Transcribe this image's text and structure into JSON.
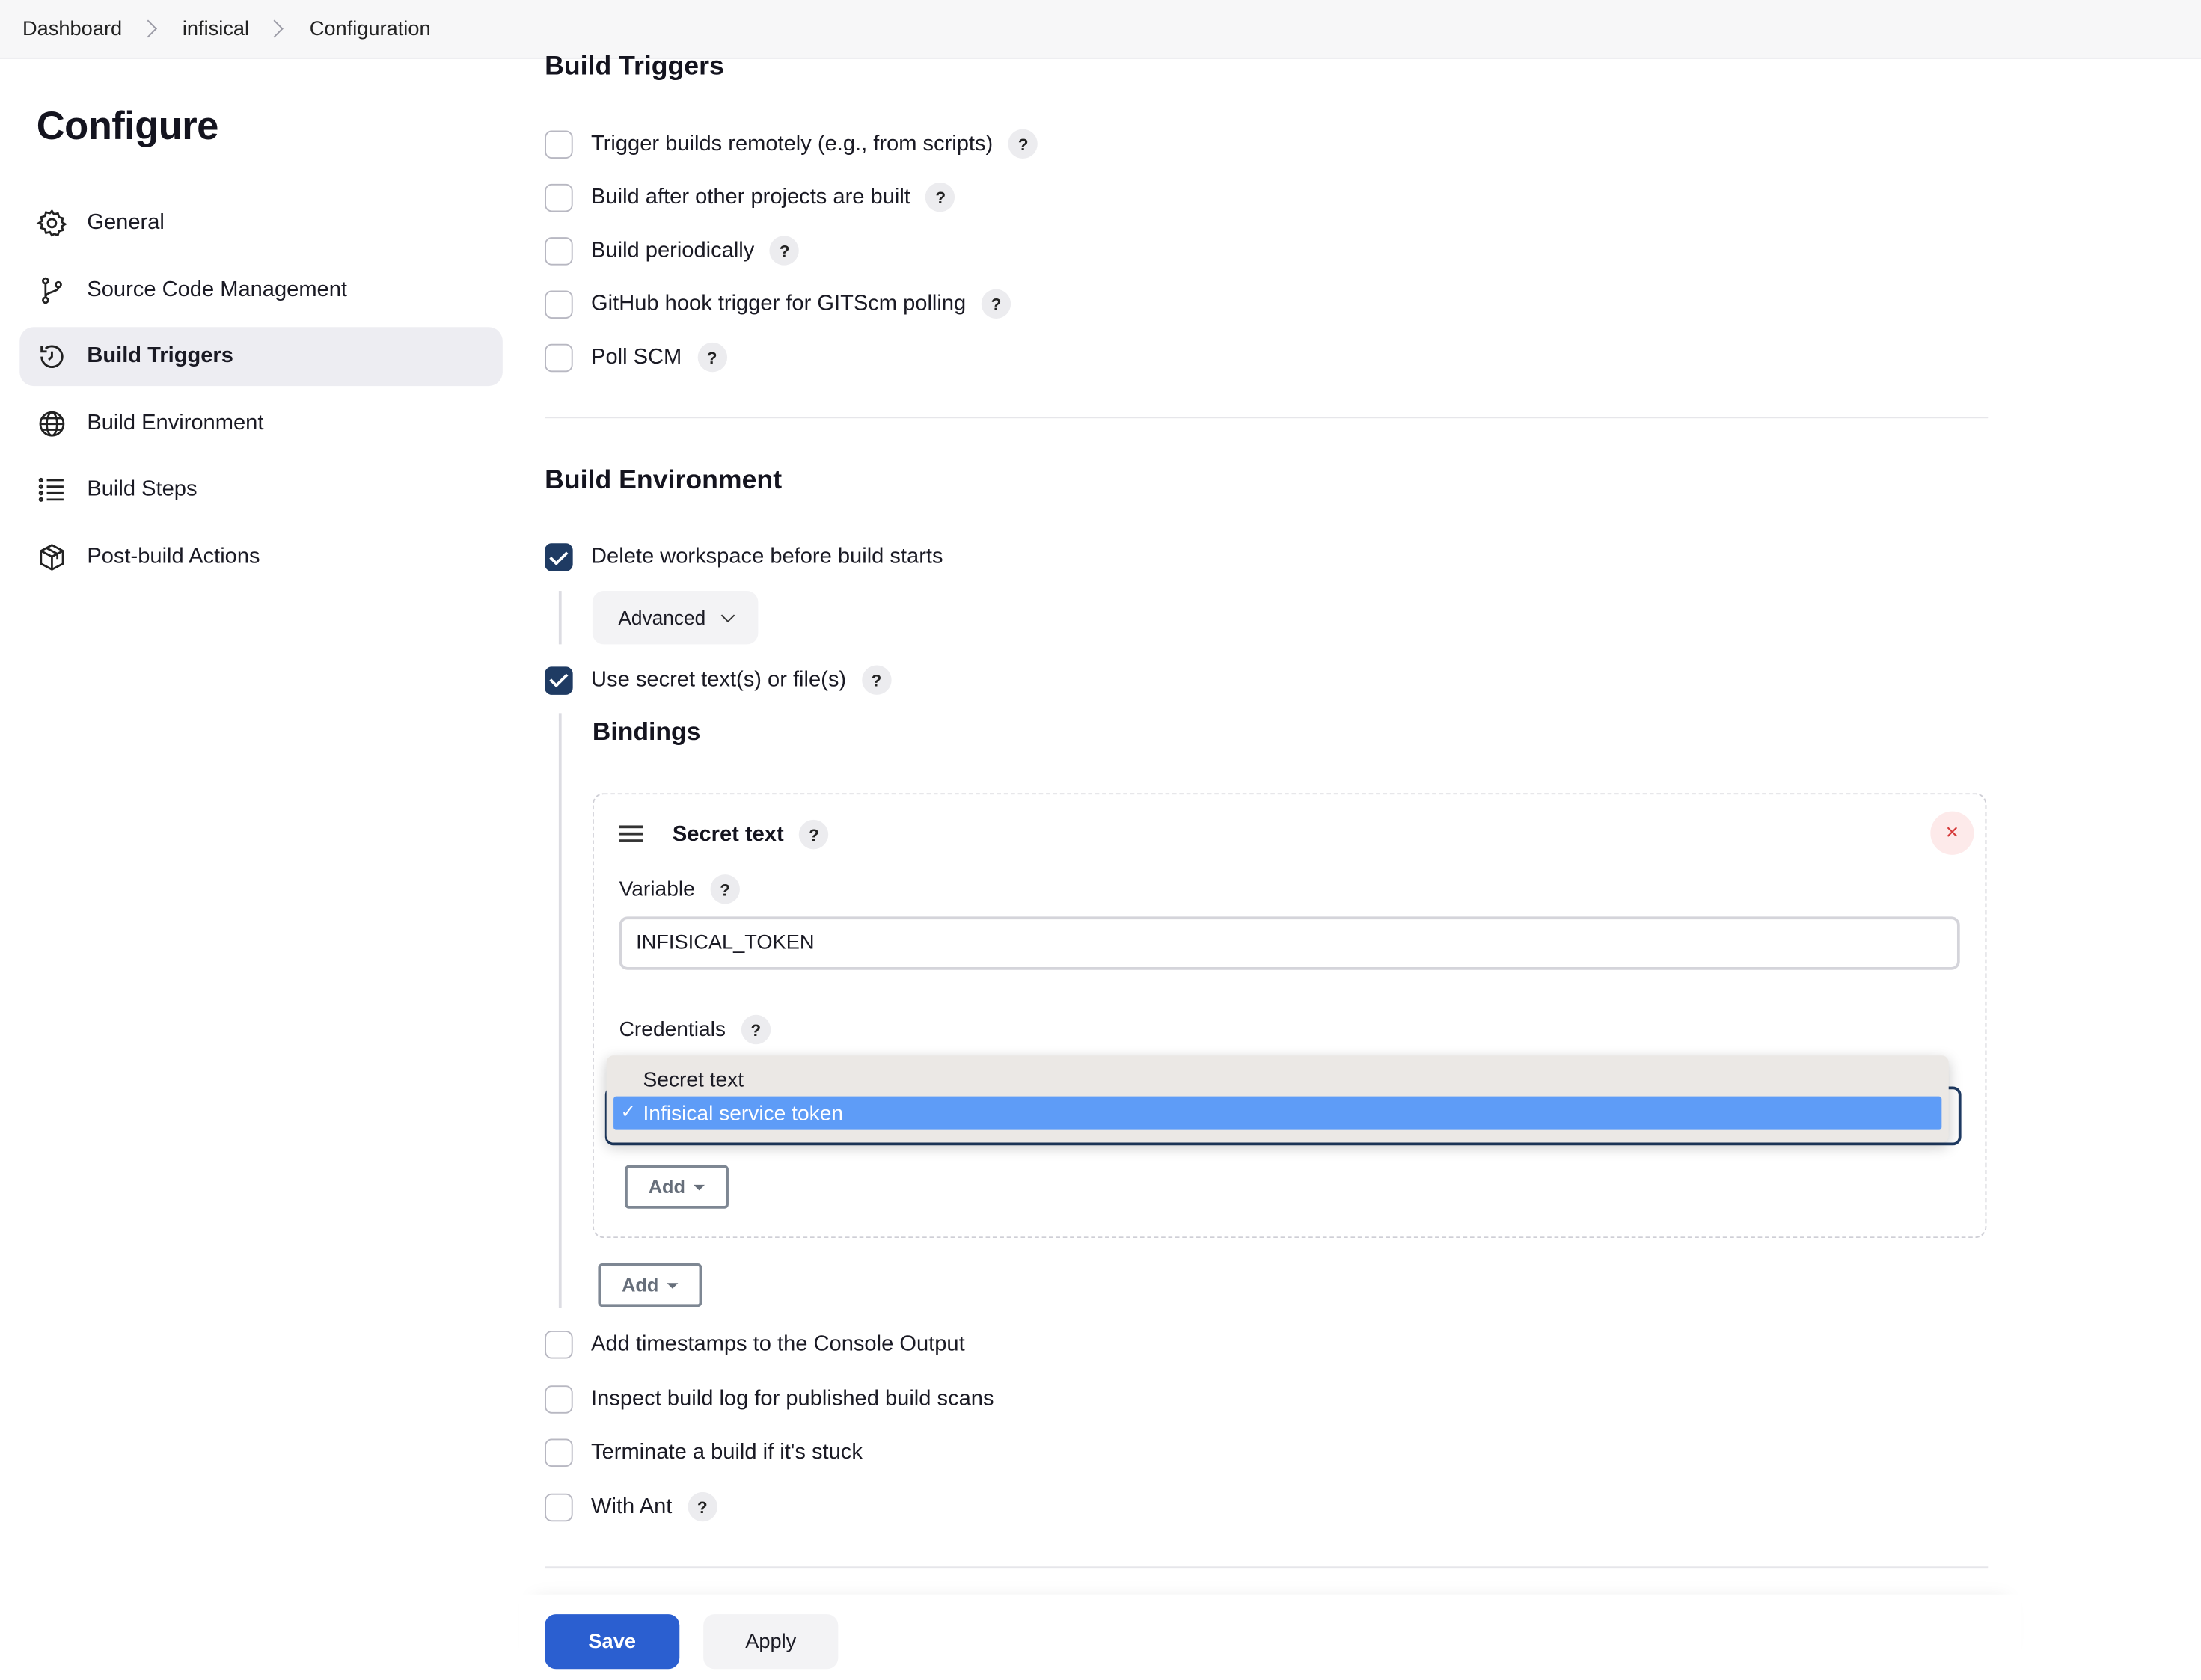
{
  "breadcrumb": [
    "Dashboard",
    "infisical",
    "Configuration"
  ],
  "sidebar": {
    "title": "Configure",
    "items": [
      {
        "label": "General",
        "icon": "gear-icon"
      },
      {
        "label": "Source Code Management",
        "icon": "branch-icon"
      },
      {
        "label": "Build Triggers",
        "icon": "clock-icon",
        "active": true
      },
      {
        "label": "Build Environment",
        "icon": "globe-icon"
      },
      {
        "label": "Build Steps",
        "icon": "list-icon"
      },
      {
        "label": "Post-build Actions",
        "icon": "package-icon"
      }
    ]
  },
  "build_triggers": {
    "title": "Build Triggers",
    "options": [
      {
        "label": "Trigger builds remotely (e.g., from scripts)",
        "checked": false,
        "help": "?"
      },
      {
        "label": "Build after other projects are built",
        "checked": false,
        "help": "?"
      },
      {
        "label": "Build periodically",
        "checked": false,
        "help": "?"
      },
      {
        "label": "GitHub hook trigger for GITScm polling",
        "checked": false,
        "help": "?"
      },
      {
        "label": "Poll SCM",
        "checked": false,
        "help": "?"
      }
    ]
  },
  "build_environment": {
    "title": "Build Environment",
    "delete_workspace": {
      "label": "Delete workspace before build starts",
      "checked": true
    },
    "advanced_label": "Advanced",
    "use_secret": {
      "label": "Use secret text(s) or file(s)",
      "checked": true,
      "help": "?"
    },
    "bindings": {
      "title": "Bindings",
      "card": {
        "title": "Secret text",
        "help": "?",
        "close": "×",
        "variable_label": "Variable",
        "variable_value": "INFISICAL_TOKEN",
        "credentials_label": "Credentials",
        "dropdown_options": [
          "Secret text",
          "Infisical service token"
        ],
        "selected_option": "Infisical service token",
        "selected_check": "✓",
        "add_label": "Add"
      },
      "add_label": "Add"
    },
    "more_options": [
      {
        "label": "Add timestamps to the Console Output",
        "checked": false
      },
      {
        "label": "Inspect build log for published build scans",
        "checked": false
      },
      {
        "label": "Terminate a build if it's stuck",
        "checked": false
      },
      {
        "label": "With Ant",
        "checked": false,
        "help": "?"
      }
    ]
  },
  "footer": {
    "save_label": "Save",
    "apply_label": "Apply"
  },
  "colors": {
    "accent": "#2b5fd0",
    "checked": "#1f3b63",
    "selection": "#5e9cf7",
    "danger": "#d53a3a"
  }
}
